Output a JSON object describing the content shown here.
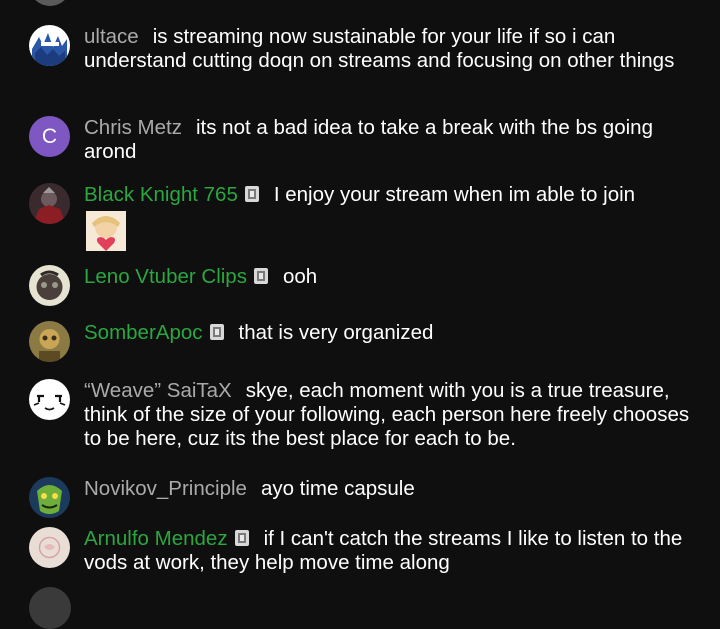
{
  "chat": {
    "messages": [
      {
        "author": "ultace",
        "member": false,
        "text": "is streaming now sustainable for your life if so i can understand cutting doqn on streams and focusing on other things"
      },
      {
        "author": "Chris Metz",
        "member": false,
        "avatar_letter": "C",
        "text": "its not a bad idea to take a break with the bs going arond"
      },
      {
        "author": "Black Knight 765",
        "member": true,
        "text": "I enjoy your stream when im able to join"
      },
      {
        "author": "Leno Vtuber Clips",
        "member": true,
        "text": "ooh"
      },
      {
        "author": "SomberApoc",
        "member": true,
        "text": "that is very organized"
      },
      {
        "author": "“Weave” SaiTaX",
        "member": false,
        "text": "skye, each moment with you is a true treasure, think of the size of your following, each person here freely chooses to be here, cuz its the best place for each to be."
      },
      {
        "author": "Novikov_Principle",
        "member": false,
        "text": "ayo time capsule"
      },
      {
        "author": "Arnulfo Mendez",
        "member": true,
        "text": "if I can't catch the streams I like to listen to the vods at work, they help move time along"
      }
    ]
  },
  "colors": {
    "background": "#0f0f0f",
    "author_default": "#aaaaaa",
    "author_member": "#2ba640",
    "message_text": "#ffffff",
    "letter_avatar": "#7e57c2"
  },
  "icons": {
    "member_badge": "member-badge-icon",
    "custom_emoji": "custom-emoji-sticker"
  }
}
